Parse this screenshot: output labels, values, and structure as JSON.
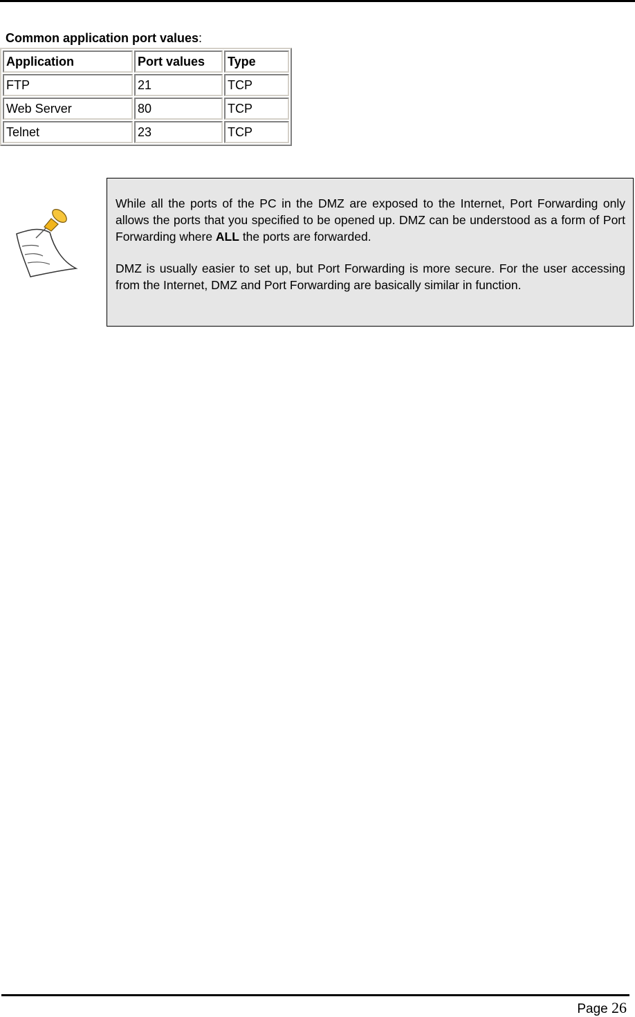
{
  "caption": {
    "bold": "Common application port values",
    "suffix": ":"
  },
  "table": {
    "headers": [
      "Application",
      "Port values",
      "Type"
    ],
    "rows": [
      [
        "FTP",
        "21",
        "TCP"
      ],
      [
        "Web Server",
        "80",
        "TCP"
      ],
      [
        "Telnet",
        "23",
        "TCP"
      ]
    ]
  },
  "note": {
    "icon": "note-pin-icon",
    "p1_before": "While all the ports of the PC in the DMZ are exposed to the Internet, Port Forwarding only allows the ports that you specified to be opened up. DMZ can be understood as a form of Port Forwarding where ",
    "p1_bold": "ALL",
    "p1_after": " the ports are forwarded.",
    "p2": "DMZ is usually easier to set up, but Port Forwarding is more secure. For the user accessing from the Internet, DMZ and Port Forwarding are basically similar in function."
  },
  "footer": {
    "label": "Page",
    "number": "26"
  }
}
